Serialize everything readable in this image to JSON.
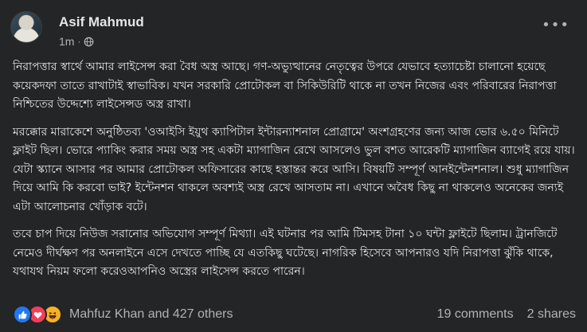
{
  "post": {
    "author": "Asif Mahmud",
    "time": "1m",
    "separator": "·",
    "audience_icon": "globe-icon",
    "paragraphs": [
      "নিরাপত্তার স্বার্থে আমার লাইসেন্স করা বৈধ অস্ত্র আছে। গণ-অভ্যুত্থানের নেতৃত্বের উপরে যেভাবে হত্যাচেষ্টা চালানো হয়েছে কয়েকদফা তাতে রাখাটাই স্বাভাবিক। যখন সরকারি প্রোটোকল বা সিকিউরিটি থাকে না তখন নিজের এবং পরিবারের নিরাপত্তা নিশ্চিতের উদ্দেশ্যে লাইসেন্সড অস্ত্র রাখা।",
      "মরক্কোর মারাকেশে অনুষ্ঠিতব্য 'ওআইসি ইয়ুথ ক্যাপিটাল ইন্টারন্যাশনাল প্রোগ্রামে' অংশগ্রহণের জন্য আজ ভোর ৬.৫০ মিনিটে ফ্লাইট ছিল। ভোরে প্যাকিং করার সময় অস্ত্র সহ একটা ম্যাগাজিন রেখে আসলেও ভুল বশত আরেকটি ম্যাগাজিন ব্যাগেই রয়ে যায়। যেটা স্ক্যানে আসার পর আমার প্রোটোকল অফিসারের কাছে হস্তান্তর করে আসি। বিষয়টি সম্পূর্ণ আনইন্টেনশনাল। শুধু ম্যাগাজিন দিয়ে আমি কি করবো ভাই? ইন্টেনশন থাকলে অবশ্যই অস্ত্র রেখে আসতাম না। এখানে অবৈধ কিছু না থাকলেও অনেকের জন্যই এটা আলোচনার খোঁড়াক বটে।",
      "তবে চাপ দিয়ে নিউজ সরানোর অভিযোগ সম্পূর্ণ মিথ্যা। এই ঘটনার পর আমি টিমসহ টানা ১০ ঘন্টা ফ্লাইটে ছিলাম। ট্রানজিটে নেমেও দীর্ঘক্ষণ পর অনলাইনে এসে দেখতে পাচ্ছি যে এতকিছু ঘটেছে। নাগরিক হিসেবে আপনারও যদি নিরাপত্তা ঝুঁকি থাকে, যথাযথ নিয়ম ফলো করেওআপনিও অস্ত্রের লাইসেন্স করতে পারেন।"
    ]
  },
  "footer": {
    "reaction_icons": [
      "like-icon",
      "love-icon",
      "haha-icon"
    ],
    "reaction_names": "Mahfuz Khan and 427 others",
    "comments": "19 comments",
    "shares": "2 shares"
  },
  "colors": {
    "background": "#242526",
    "primary_text": "#e4e6eb",
    "secondary_text": "#b0b3b8",
    "like": "#2078f4",
    "love": "#f33e58",
    "haha": "#f7b125"
  }
}
